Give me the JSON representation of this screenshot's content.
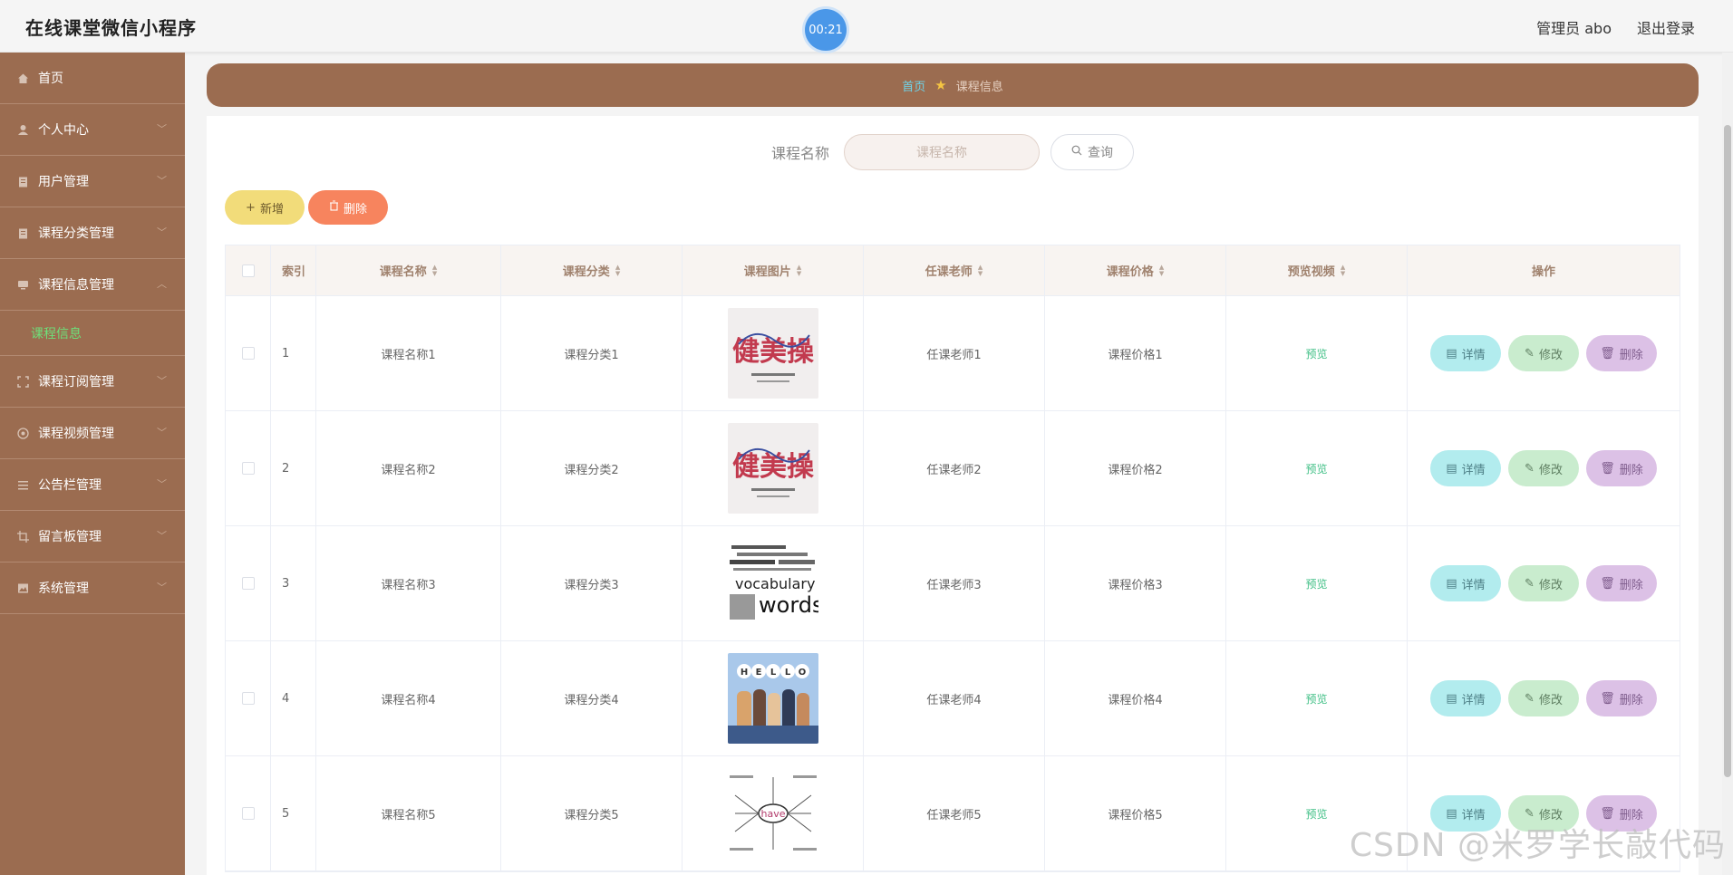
{
  "header": {
    "app_title": "在线课堂微信小程序",
    "timer": "00:21",
    "user_label": "管理员 abo",
    "logout_label": "退出登录"
  },
  "sidebar": {
    "items": [
      {
        "label": "首页",
        "icon": "home-icon"
      },
      {
        "label": "个人中心",
        "icon": "user-icon"
      },
      {
        "label": "用户管理",
        "icon": "clipboard-icon"
      },
      {
        "label": "课程分类管理",
        "icon": "clipboard-icon"
      },
      {
        "label": "课程信息管理",
        "icon": "monitor-icon"
      },
      {
        "label": "课程信息",
        "icon": ""
      },
      {
        "label": "课程订阅管理",
        "icon": "fullscreen-icon"
      },
      {
        "label": "课程视频管理",
        "icon": "aperture-icon"
      },
      {
        "label": "公告栏管理",
        "icon": "list-icon"
      },
      {
        "label": "留言板管理",
        "icon": "crop-icon"
      },
      {
        "label": "系统管理",
        "icon": "image-icon"
      }
    ]
  },
  "breadcrumb": {
    "home": "首页",
    "current": "课程信息"
  },
  "search": {
    "label": "课程名称",
    "placeholder": "课程名称",
    "button": "查询"
  },
  "toolbar": {
    "add_label": "新增",
    "delete_label": "删除"
  },
  "table": {
    "headers": [
      "索引",
      "课程名称",
      "课程分类",
      "课程图片",
      "任课老师",
      "课程价格",
      "预览视频",
      "操作"
    ],
    "rows": [
      {
        "index": "1",
        "name": "课程名称1",
        "category": "课程分类1",
        "image": "jianmeicao-poster",
        "teacher": "任课老师1",
        "price": "课程价格1",
        "video": "预览"
      },
      {
        "index": "2",
        "name": "课程名称2",
        "category": "课程分类2",
        "image": "jianmeicao-poster",
        "teacher": "任课老师2",
        "price": "课程价格2",
        "video": "预览"
      },
      {
        "index": "3",
        "name": "课程名称3",
        "category": "课程分类3",
        "image": "vocabulary-words",
        "teacher": "任课老师3",
        "price": "课程价格3",
        "video": "预览"
      },
      {
        "index": "4",
        "name": "课程名称4",
        "category": "课程分类4",
        "image": "hello-people",
        "teacher": "任课老师4",
        "price": "课程价格4",
        "video": "预览"
      },
      {
        "index": "5",
        "name": "课程名称5",
        "category": "课程分类5",
        "image": "have-mindmap",
        "teacher": "任课老师5",
        "price": "课程价格5",
        "video": "预览"
      }
    ],
    "actions": {
      "detail": "详情",
      "edit": "修改",
      "delete": "删除"
    }
  },
  "thumb_text": {
    "jianmeicao": "健美操",
    "vocabulary": "vocabulary",
    "words": "words",
    "hello": [
      "H",
      "E",
      "L",
      "L",
      "O"
    ],
    "have": "have"
  },
  "watermark": "CSDN @米罗学长敲代码",
  "colors": {
    "sidebar": "#9b6c50",
    "accent_green": "#6ee07a",
    "timer": "#4a97e8",
    "add": "#f2dc7a",
    "delete": "#f7845e"
  }
}
